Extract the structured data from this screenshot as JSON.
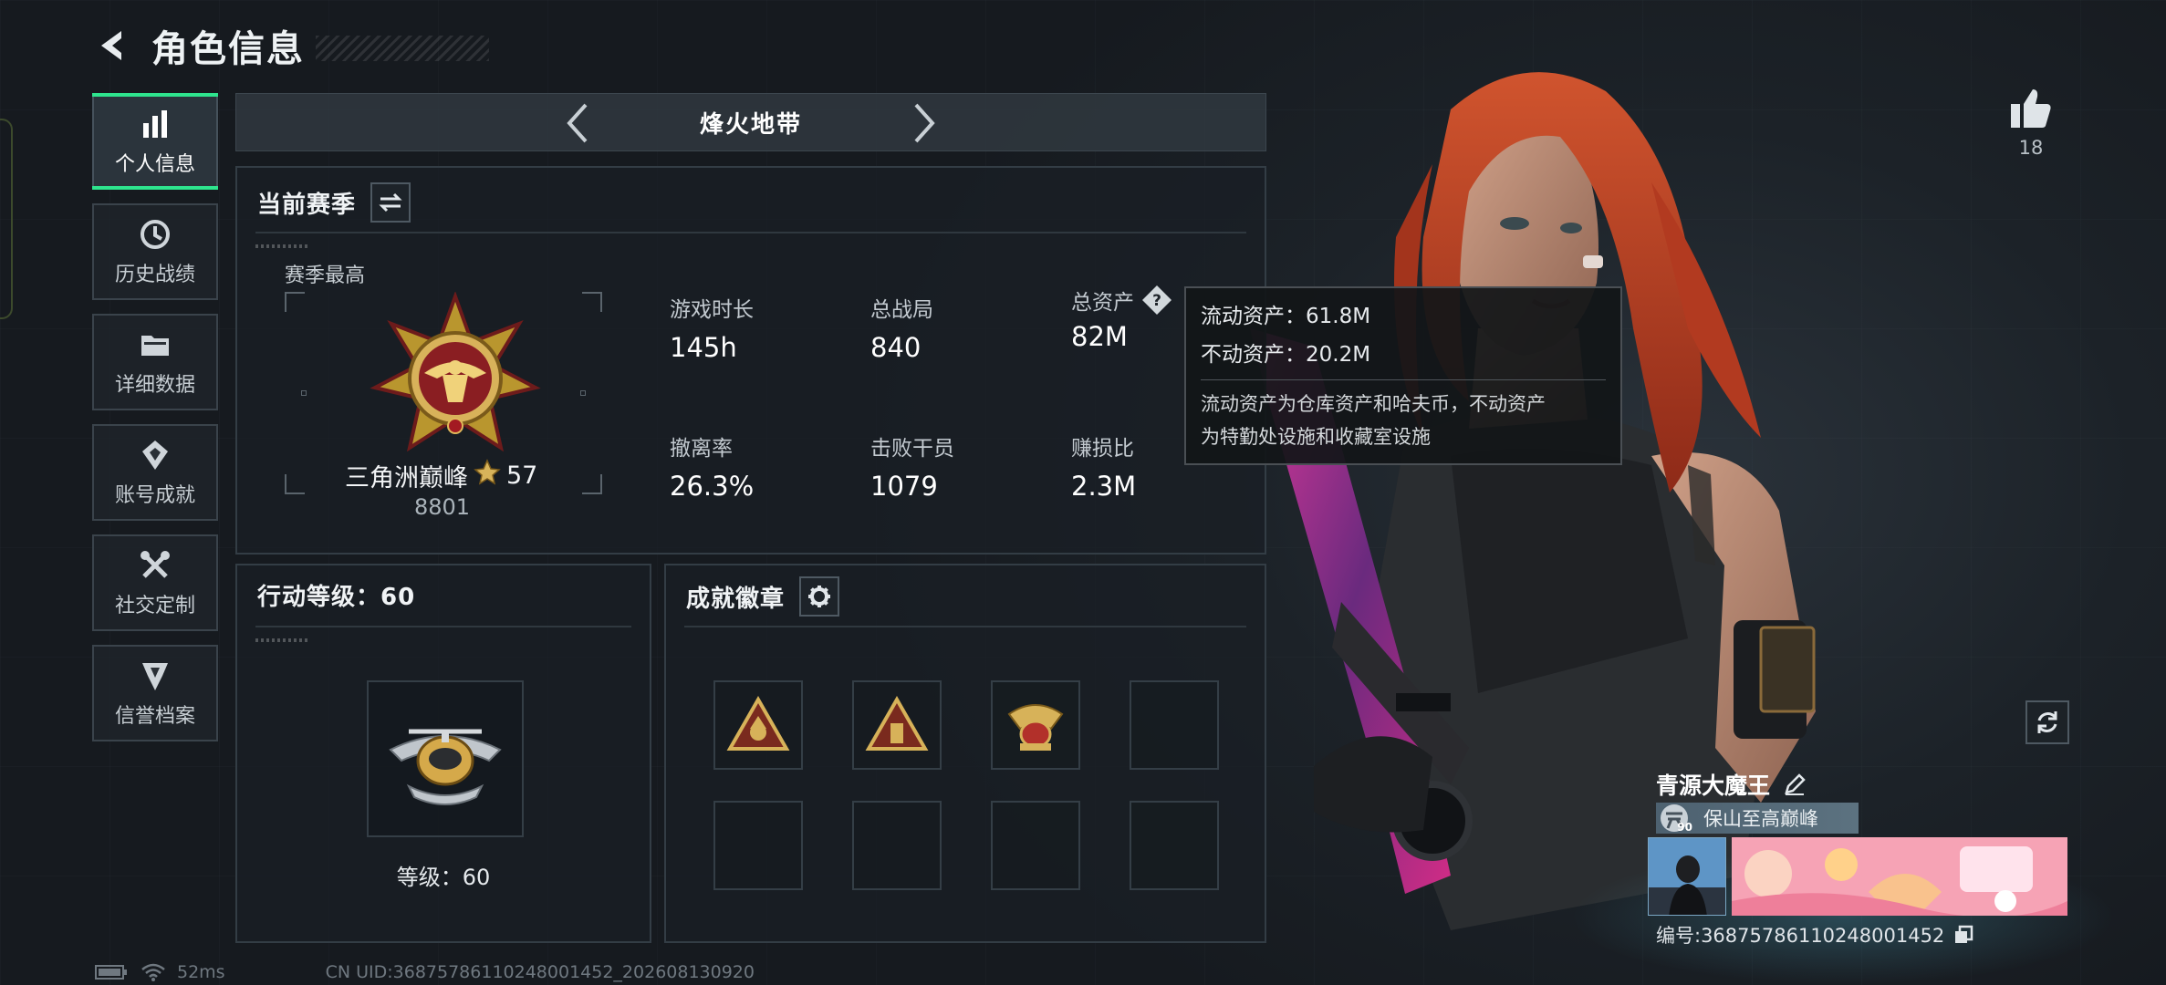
{
  "header": {
    "title": "角色信息"
  },
  "sidebar": {
    "items": [
      {
        "label": "个人信息",
        "icon": "bar-chart-icon",
        "active": true
      },
      {
        "label": "历史战绩",
        "icon": "history-icon",
        "active": false
      },
      {
        "label": "详细数据",
        "icon": "folder-icon",
        "active": false
      },
      {
        "label": "账号成就",
        "icon": "achievement-icon",
        "active": false
      },
      {
        "label": "社交定制",
        "icon": "tools-icon",
        "active": false
      },
      {
        "label": "信誉档案",
        "icon": "reputation-icon",
        "active": false
      }
    ]
  },
  "mode": {
    "title": "烽火地带"
  },
  "season": {
    "title": "当前赛季",
    "best_label": "赛季最高",
    "rank_name": "三角洲巅峰",
    "rank_stars": "57",
    "rank_score": "8801",
    "stats": [
      {
        "label": "游戏时长",
        "value": "145h"
      },
      {
        "label": "总战局",
        "value": "840"
      },
      {
        "label": "总资产",
        "value": "82M"
      },
      {
        "label": "撤离率",
        "value": "26.3%"
      },
      {
        "label": "击败干员",
        "value": "1079"
      },
      {
        "label": "赚损比",
        "value": "2.3M"
      }
    ]
  },
  "tooltip": {
    "liquid": "流动资产：61.8M",
    "fixed": "不动资产：20.2M",
    "note_line1": "流动资产为仓库资产和哈夫币，不动资产",
    "note_line2": "为特勤处设施和收藏室设施"
  },
  "level": {
    "title": "行动等级：60",
    "text": "等级：60"
  },
  "badges": {
    "title": "成就徽章"
  },
  "likes": {
    "count": "18"
  },
  "player": {
    "name": "青源大魔王",
    "title_badge_level": "90",
    "title_text": "保山至高巅峰",
    "id": "编号:36875786110248001452"
  },
  "footer": {
    "ping": "52ms",
    "uid": "CN UID:36875786110248001452_202608130920"
  },
  "colors": {
    "accent": "#2ee58e",
    "gold": "#c9a24a",
    "hair": "#c8452a"
  }
}
